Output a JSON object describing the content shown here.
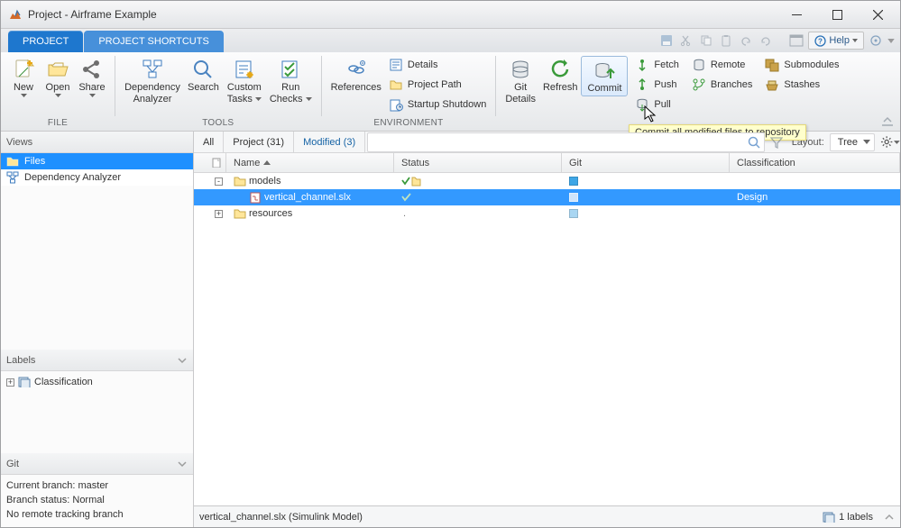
{
  "window": {
    "title": "Project - Airframe Example"
  },
  "tabs": {
    "project": "PROJECT",
    "shortcuts": "PROJECT SHORTCUTS",
    "help": "Help"
  },
  "ribbon": {
    "file_cap": "FILE",
    "tools_cap": "TOOLS",
    "env_cap": "ENVIRONMENT",
    "new": "New",
    "open": "Open",
    "share": "Share",
    "dep": "Dependency",
    "dep2": "Analyzer",
    "search": "Search",
    "custom": "Custom",
    "custom2": "Tasks",
    "run": "Run",
    "run2": "Checks",
    "ref": "References",
    "details": "Details",
    "projpath": "Project Path",
    "startup": "Startup Shutdown",
    "gitdetails": "Git",
    "gitdetails2": "Details",
    "refresh": "Refresh",
    "commit": "Commit",
    "fetch": "Fetch",
    "push": "Push",
    "pull": "Pull",
    "remote": "Remote",
    "branches": "Branches",
    "submodules": "Submodules",
    "stashes": "Stashes"
  },
  "tooltip": "Commit all modified files to repository",
  "left": {
    "views": "Views",
    "labels": "Labels",
    "git": "Git",
    "v_files": "Files",
    "v_dep": "Dependency Analyzer",
    "l_class": "Classification",
    "g_branch": "Current branch: master",
    "g_status": "Branch status: Normal",
    "g_remote": "No remote tracking branch"
  },
  "toolbar": {
    "all": "All",
    "project": "Project (31)",
    "modified": "Modified (3)",
    "layout_label": "Layout:",
    "layout_value": "Tree",
    "search_placeholder": ""
  },
  "grid": {
    "h_name": "Name",
    "h_status": "Status",
    "h_git": "Git",
    "h_class": "Classification",
    "rows": [
      {
        "expand": "-",
        "icon": "folder",
        "name": "models",
        "status": "check-folder",
        "git": "sq-blue",
        "class": ""
      },
      {
        "expand": "",
        "icon": "slx",
        "name": "vertical_channel.slx",
        "status": "check",
        "git": "sq-outline",
        "class": "Design",
        "selected": true,
        "indent": 1
      },
      {
        "expand": "+",
        "icon": "folder",
        "name": "resources",
        "status": "dot",
        "git": "sq-light",
        "class": ""
      }
    ]
  },
  "status": {
    "left": "vertical_channel.slx (Simulink Model)",
    "labels": "1 labels"
  }
}
